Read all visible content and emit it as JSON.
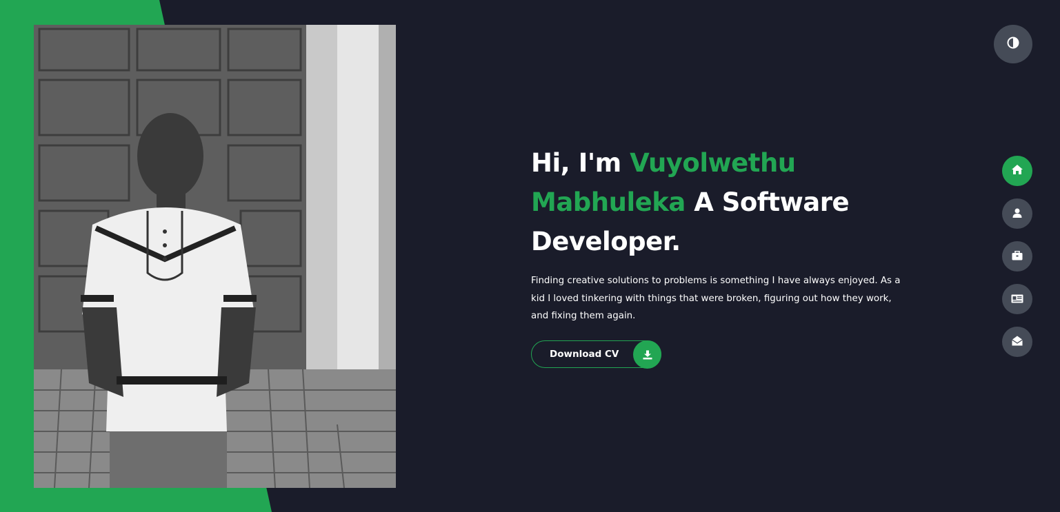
{
  "colors": {
    "accent": "#22a653",
    "background": "#1a1c2a",
    "nav_button": "#454b57",
    "text": "#ffffff"
  },
  "profile_photo": {
    "alt": "Vuyolwethu Mabhuleka portrait"
  },
  "theme_toggle": {
    "icon": "contrast-icon"
  },
  "nav": {
    "items": [
      {
        "id": "home",
        "icon": "home-icon",
        "active": true
      },
      {
        "id": "about",
        "icon": "user-icon",
        "active": false
      },
      {
        "id": "portfolio",
        "icon": "briefcase-icon",
        "active": false
      },
      {
        "id": "blog",
        "icon": "id-card-icon",
        "active": false
      },
      {
        "id": "contact",
        "icon": "envelope-open-icon",
        "active": false
      }
    ]
  },
  "hero": {
    "greeting": "Hi, I'm",
    "name": "Vuyolwethu Mabhuleka",
    "role": "A Software Developer.",
    "description": "Finding creative solutions to problems is something I have always enjoyed. As a kid I loved tinkering with things that were broken, figuring out how they work, and fixing them again.",
    "cta_label": "Download CV",
    "cta_icon": "download-icon"
  }
}
